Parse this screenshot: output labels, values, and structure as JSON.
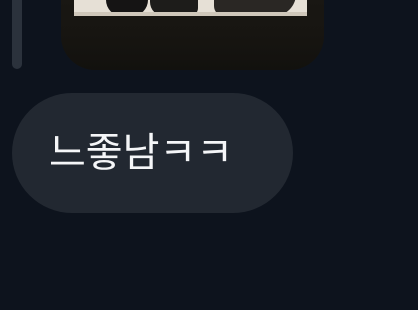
{
  "chat": {
    "messages": [
      {
        "type": "image",
        "sender": "other"
      },
      {
        "type": "text",
        "sender": "other",
        "text": "느좋남ㅋㅋ"
      }
    ]
  },
  "colors": {
    "background": "#0d131d",
    "incoming_bubble": "#222831",
    "message_text": "#f5f6f8"
  }
}
